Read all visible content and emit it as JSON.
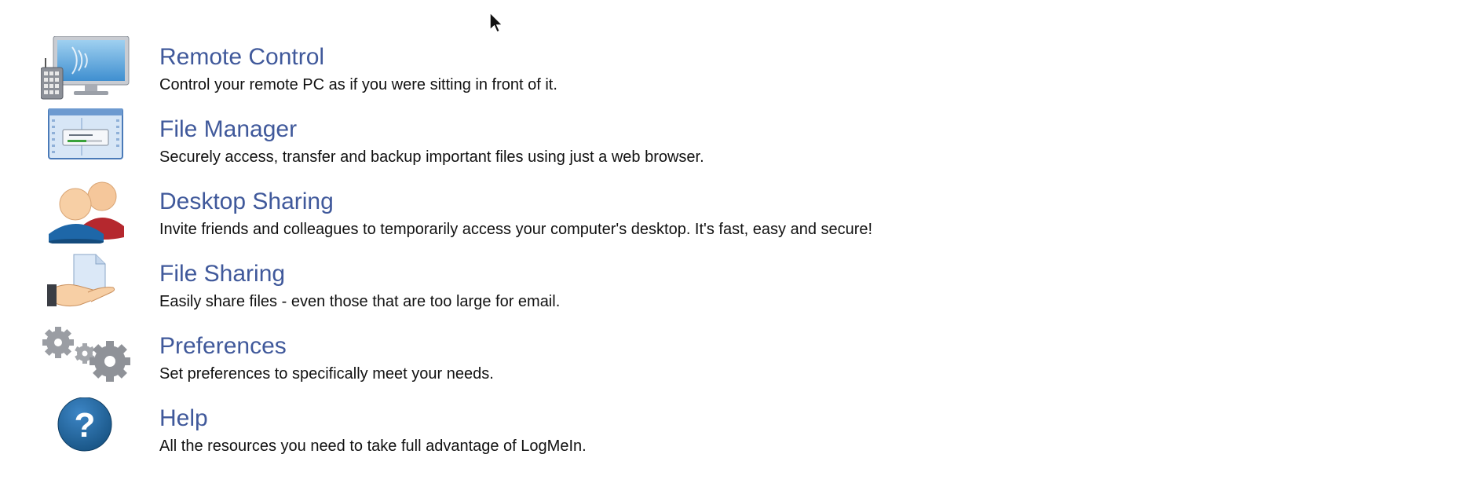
{
  "menu": {
    "items": [
      {
        "icon": "remote-control-monitor-icon",
        "title": "Remote Control",
        "description": "Control your remote PC as if you were sitting in front of it."
      },
      {
        "icon": "file-manager-window-icon",
        "title": "File Manager",
        "description": "Securely access, transfer and backup important files using just a web browser."
      },
      {
        "icon": "users-icon",
        "title": "Desktop Sharing",
        "description": "Invite friends and colleagues to temporarily access your computer's desktop. It's fast, easy and secure!"
      },
      {
        "icon": "hand-document-icon",
        "title": "File Sharing",
        "description": "Easily share files - even those that are too large for email."
      },
      {
        "icon": "gears-icon",
        "title": "Preferences",
        "description": "Set preferences to specifically meet your needs."
      },
      {
        "icon": "help-question-icon",
        "title": "Help",
        "description": "All the resources you need to take full advantage of LogMeIn."
      }
    ]
  },
  "colors": {
    "title": "#40599b",
    "text": "#111111",
    "help_icon": "#1d5f97"
  }
}
